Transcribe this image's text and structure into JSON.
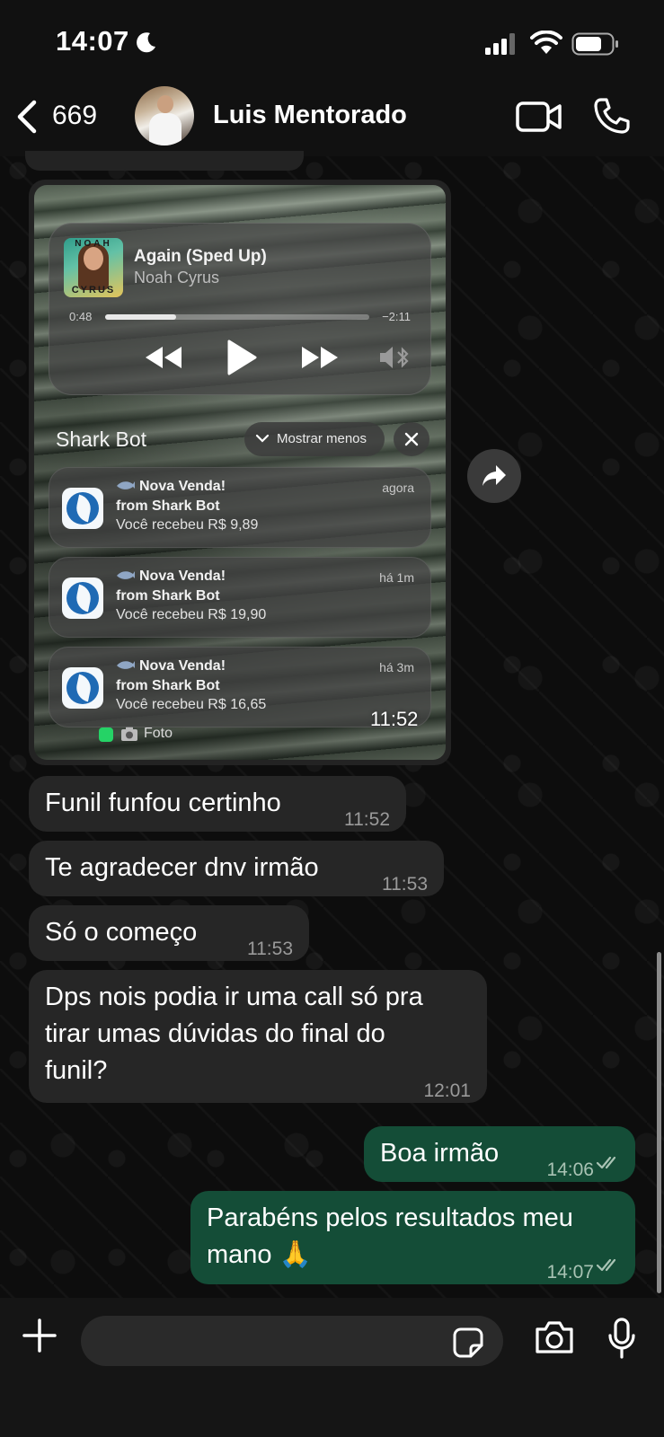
{
  "status_bar": {
    "time": "14:07"
  },
  "header": {
    "back_count": "669",
    "contact_name": "Luis Mentorado"
  },
  "photo_message": {
    "music": {
      "album_label_top": "NOAH",
      "album_label_bottom": "CYRUS",
      "title": "Again (Sped Up)",
      "artist": "Noah Cyrus",
      "elapsed": "0:48",
      "remaining": "−2:11",
      "progress_fraction": 0.27
    },
    "group_label": "Shark Bot",
    "show_less_label": "Mostrar menos",
    "notifications": [
      {
        "title": "Nova Venda!",
        "from": "from Shark Bot",
        "body": "Você recebeu R$ 9,89",
        "time": "agora"
      },
      {
        "title": "Nova Venda!",
        "from": "from Shark Bot",
        "body": "Você recebeu R$ 19,90",
        "time": "há 1m"
      },
      {
        "title": "Nova Venda!",
        "from": "from Shark Bot",
        "body": "Você recebeu R$ 16,65",
        "time": "há 3m"
      }
    ],
    "stack_hint": "Foto",
    "time": "11:52"
  },
  "messages": [
    {
      "direction": "in",
      "text": "Funil funfou certinho",
      "time": "11:52"
    },
    {
      "direction": "in",
      "text": "Te agradecer dnv irmão",
      "time": "11:53"
    },
    {
      "direction": "in",
      "text": "Só o começo",
      "time": "11:53"
    },
    {
      "direction": "in",
      "text_lines": [
        "Dps nois podia ir uma call só pra",
        "tirar umas dúvidas do final do",
        "funil?"
      ],
      "time": "12:01"
    },
    {
      "direction": "out",
      "text": "Boa irmão",
      "time": "14:06",
      "status": "read"
    },
    {
      "direction": "out",
      "text_lines": [
        "Parabéns pelos resultados meu",
        "mano 🙏"
      ],
      "time": "14:07",
      "status": "read"
    }
  ],
  "colors": {
    "outgoing_bubble": "#144d37",
    "incoming_bubble": "#262626",
    "read_ticks": "#a9c3b4"
  }
}
